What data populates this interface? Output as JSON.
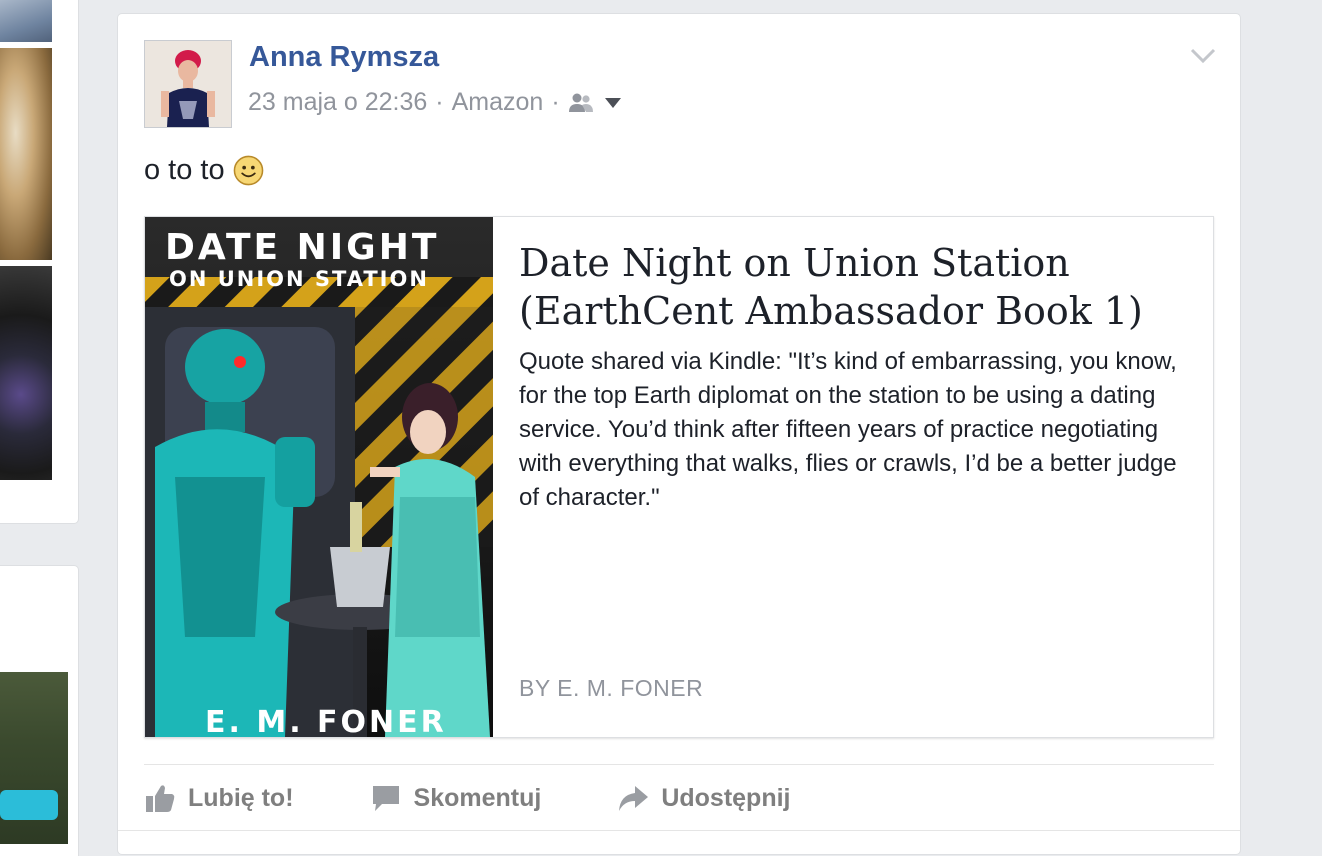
{
  "post": {
    "author": "Anna Rymsza",
    "date": "23 maja o 22:36",
    "separator": "·",
    "via": "Amazon",
    "audience_icon": "friends-icon",
    "text": "o to to",
    "emoji": "smiley"
  },
  "attachment": {
    "cover_title_line1": "DATE NIGHT",
    "cover_title_line2": "ON UNION STATION",
    "cover_author": "E. M. FONER",
    "title": "Date Night on Union Station (EarthCent Ambassador Book 1)",
    "description": "Quote shared via Kindle: \"It’s kind of embarrassing, you know, for the top Earth diplomat on the station to be using a dating service. You’d think after fifteen years of practice negotiating with everything that walks, flies or crawls, I’d be a better judge of character.\"",
    "byline": "BY E. M. FONER"
  },
  "actions": {
    "like": "Lubię to!",
    "comment": "Skomentuj",
    "share": "Udostępnij"
  },
  "colors": {
    "link": "#365899",
    "muted": "#90949c",
    "background": "#e9ebee"
  }
}
